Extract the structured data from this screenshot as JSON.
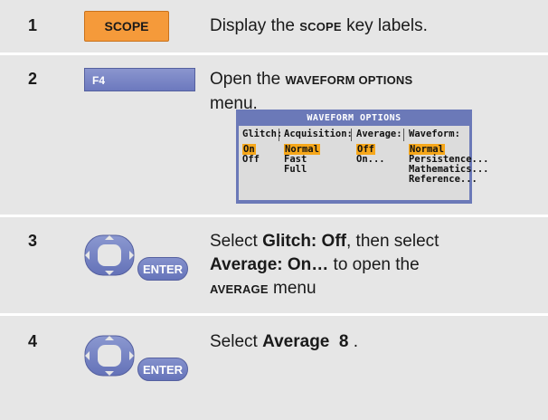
{
  "steps": [
    {
      "num": "1",
      "key": "SCOPE",
      "text_a": "Display the ",
      "text_b": "SCOPE",
      "text_c": " key labels."
    },
    {
      "num": "2",
      "key": "F4",
      "text_a": "Open the ",
      "text_b": "WAVEFORM OPTIONS",
      "text_c": "menu."
    },
    {
      "num": "3",
      "key": "ENTER",
      "text_a": "Select ",
      "text_b": "Glitch: Off",
      "text_c": ", then select",
      "text_d": "Average: On…",
      "text_e": " to open the",
      "text_f": "AVERAGE",
      "text_g": " menu"
    },
    {
      "num": "4",
      "key": "ENTER",
      "text_a": "Select ",
      "text_b": "Average  8",
      "text_c": " ."
    }
  ],
  "menu": {
    "title": "WAVEFORM OPTIONS",
    "columns": [
      {
        "header": "Glitch:",
        "options": [
          "On",
          "Off"
        ],
        "selected": 0
      },
      {
        "header": "Acquisition:",
        "options": [
          "Normal",
          "Fast",
          "Full"
        ],
        "selected": 0
      },
      {
        "header": "Average:",
        "options": [
          "Off",
          "On..."
        ],
        "selected": 0
      },
      {
        "header": "Waveform:",
        "options": [
          "Normal",
          "Persistence...",
          "Mathematics...",
          "Reference..."
        ],
        "selected": 0
      }
    ],
    "colors": {
      "frame": "#6b79b8",
      "body": "#dcdcdc",
      "highlight": "#f6a71a"
    }
  },
  "colors": {
    "row_bg": "#e6e6e6",
    "scope_key": "#f59a3a",
    "blue_key": "#6c79be"
  }
}
